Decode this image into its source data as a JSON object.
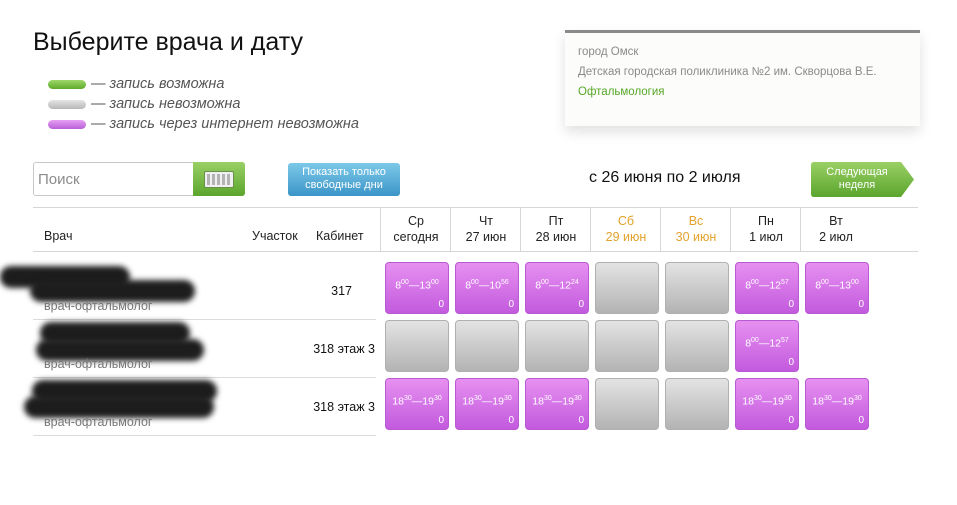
{
  "page": {
    "title": "Выберите врача и дату"
  },
  "legend": [
    {
      "label": "— запись возможна",
      "color": "#7cc44a"
    },
    {
      "label": "— запись невозможна",
      "color": "#c8c8c8"
    },
    {
      "label": "— запись через интернет невозможна",
      "color": "#d07ae6"
    }
  ],
  "info": {
    "city": "город Омск",
    "clinic": "Детская городская поликлиника №2 им. Скворцова В.Е.",
    "specialty": "Офтальмология"
  },
  "search": {
    "placeholder": "Поиск",
    "keyboard_icon": "keyboard-icon"
  },
  "buttons": {
    "free_days": "Показать только свободные дни",
    "next_week": "Следующая неделя"
  },
  "date_range": "с 26 июня по 2 июля",
  "table": {
    "headers": {
      "doctor": "Врач",
      "uchastok": "Участок",
      "cabinet": "Кабинет"
    },
    "days": [
      {
        "weekday": "Ср",
        "date": "сегодня",
        "weekend": false
      },
      {
        "weekday": "Чт",
        "date": "27 июн",
        "weekend": false
      },
      {
        "weekday": "Пт",
        "date": "28 июн",
        "weekend": false
      },
      {
        "weekday": "Сб",
        "date": "29 июн",
        "weekend": true
      },
      {
        "weekday": "Вс",
        "date": "30 июн",
        "weekend": true
      },
      {
        "weekday": "Пн",
        "date": "1 июл",
        "weekend": false
      },
      {
        "weekday": "Вт",
        "date": "2 июл",
        "weekend": false
      }
    ],
    "doctors": [
      {
        "specialty": "врач-офтальмолог",
        "cabinet": "317",
        "slots": [
          {
            "status": "internet-closed",
            "from_h": "8",
            "from_m": "00",
            "to_h": "13",
            "to_m": "00",
            "count": "0"
          },
          {
            "status": "internet-closed",
            "from_h": "8",
            "from_m": "00",
            "to_h": "10",
            "to_m": "56",
            "count": "0"
          },
          {
            "status": "internet-closed",
            "from_h": "8",
            "from_m": "00",
            "to_h": "12",
            "to_m": "24",
            "count": "0"
          },
          {
            "status": "closed"
          },
          {
            "status": "closed"
          },
          {
            "status": "internet-closed",
            "from_h": "8",
            "from_m": "00",
            "to_h": "12",
            "to_m": "57",
            "count": "0"
          },
          {
            "status": "internet-closed",
            "from_h": "8",
            "from_m": "00",
            "to_h": "13",
            "to_m": "00",
            "count": "0"
          }
        ]
      },
      {
        "specialty": "врач-офтальмолог",
        "cabinet": "318 этаж 3",
        "slots": [
          {
            "status": "closed"
          },
          {
            "status": "closed"
          },
          {
            "status": "closed"
          },
          {
            "status": "closed"
          },
          {
            "status": "closed"
          },
          {
            "status": "internet-closed",
            "from_h": "8",
            "from_m": "00",
            "to_h": "12",
            "to_m": "57",
            "count": "0"
          },
          {
            "status": "none"
          }
        ]
      },
      {
        "specialty": "врач-офтальмолог",
        "cabinet": "318 этаж 3",
        "slots": [
          {
            "status": "internet-closed",
            "from_h": "18",
            "from_m": "30",
            "to_h": "19",
            "to_m": "30",
            "count": "0"
          },
          {
            "status": "internet-closed",
            "from_h": "18",
            "from_m": "30",
            "to_h": "19",
            "to_m": "30",
            "count": "0"
          },
          {
            "status": "internet-closed",
            "from_h": "18",
            "from_m": "30",
            "to_h": "19",
            "to_m": "30",
            "count": "0"
          },
          {
            "status": "closed"
          },
          {
            "status": "closed"
          },
          {
            "status": "internet-closed",
            "from_h": "18",
            "from_m": "30",
            "to_h": "19",
            "to_m": "30",
            "count": "0"
          },
          {
            "status": "internet-closed",
            "from_h": "18",
            "from_m": "30",
            "to_h": "19",
            "to_m": "30",
            "count": "0"
          }
        ]
      }
    ]
  }
}
